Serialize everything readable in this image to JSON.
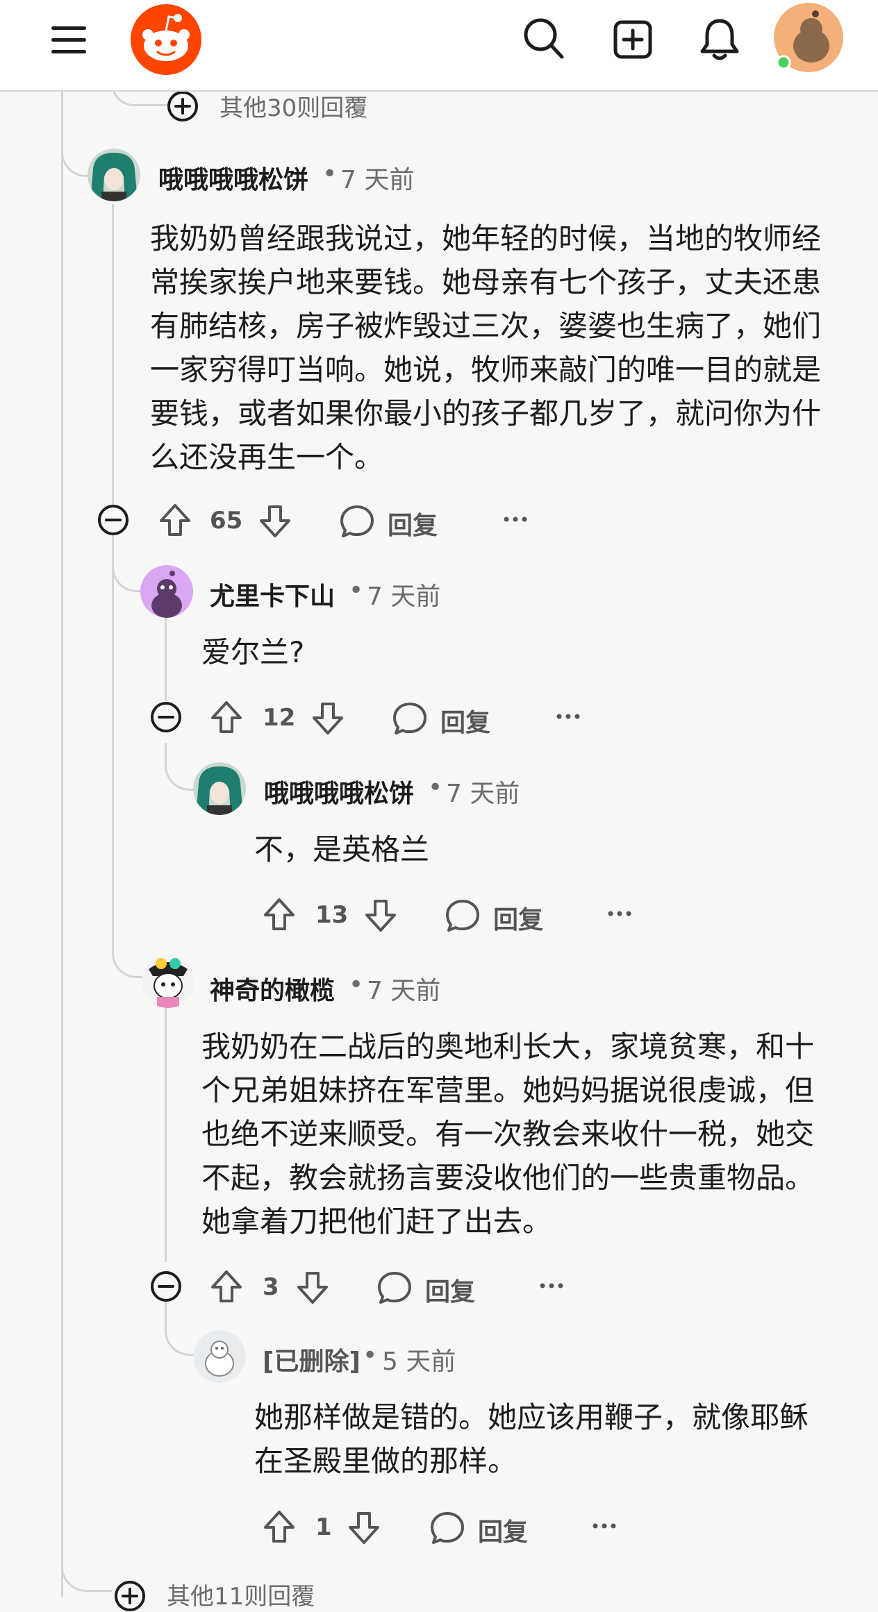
{
  "header": {
    "menu_icon": "hamburger-menu-icon",
    "logo_icon": "reddit-snoo-logo",
    "search_icon": "search-icon",
    "create_icon": "create-post-icon",
    "notification_icon": "bell-icon",
    "avatar_icon": "user-avatar"
  },
  "more_replies_top": "其他30则回覆",
  "more_replies_bottom": "其他11则回覆",
  "comments": [
    {
      "username": "哦哦哦哦松饼",
      "time": "7 天前",
      "body": "我奶奶曾经跟我说过，她年轻的时候，当地的牧师经常挨家挨户地来要钱。她母亲有七个孩子，丈夫还患有肺结核，房子被炸毁过三次，婆婆也生病了，她们一家穷得叮当响。她说，牧师来敲门的唯一目的就是要钱，或者如果你最小的孩子都几岁了，就问你为什么还没再生一个。",
      "score": "65",
      "reply_label": "回复"
    },
    {
      "username": "尤里卡下山",
      "time": "7 天前",
      "body": "爱尔兰?",
      "score": "12",
      "reply_label": "回复"
    },
    {
      "username": "哦哦哦哦松饼",
      "time": "7 天前",
      "body": "不，是英格兰",
      "score": "13",
      "reply_label": "回复"
    },
    {
      "username": "神奇的橄榄",
      "time": "7 天前",
      "body": "我奶奶在二战后的奥地利长大，家境贫寒，和十个兄弟姐妹挤在军营里。她妈妈据说很虔诚，但也绝不逆来顺受。有一次教会来收什一税，她交不起，教会就扬言要没收他们的一些贵重物品。她拿着刀把他们赶了出去。",
      "score": "3",
      "reply_label": "回复"
    },
    {
      "username": "[已删除]",
      "time": "5 天前",
      "body": "她那样做是错的。她应该用鞭子，就像耶稣在圣殿里做的那样。",
      "score": "1",
      "reply_label": "回复"
    }
  ],
  "colors": {
    "brand": "#ff4500",
    "online": "#46d160",
    "thread_line": "#d4d4d4"
  }
}
